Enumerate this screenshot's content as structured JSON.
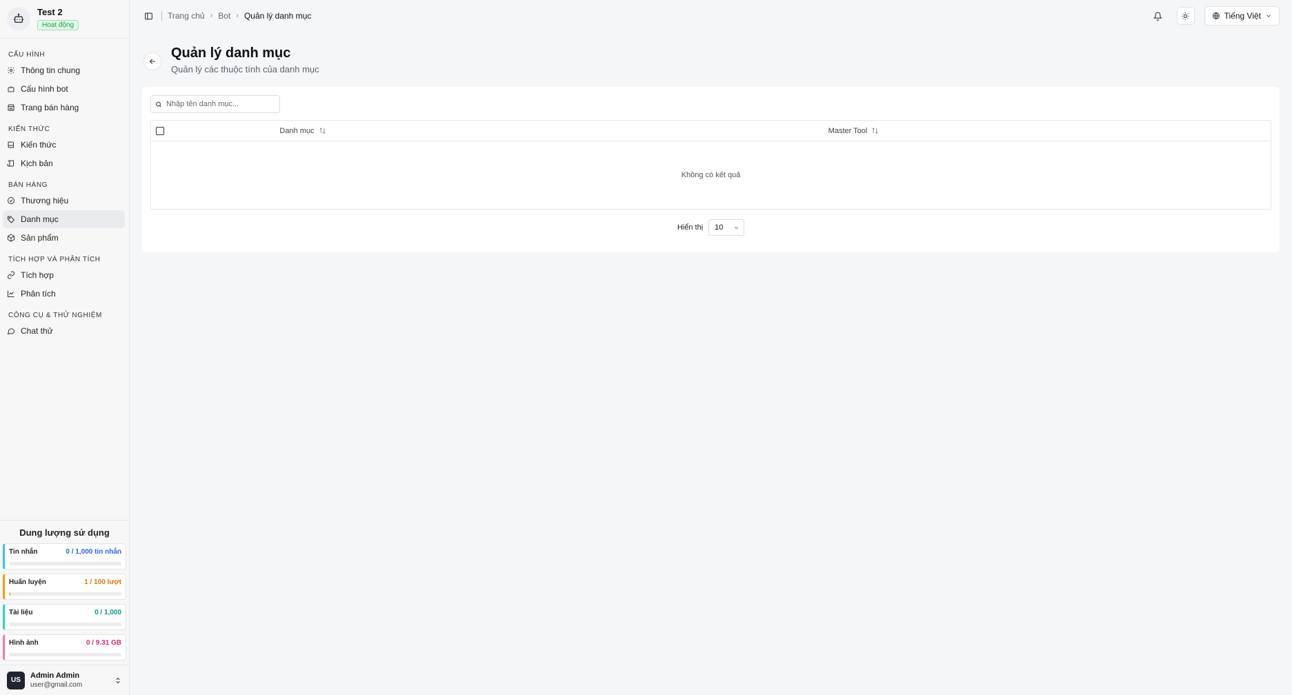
{
  "bot": {
    "name": "Test 2",
    "status": "Hoạt động"
  },
  "nav": {
    "sections": [
      {
        "title": "CẤU HÌNH",
        "items": [
          {
            "label": "Thông tin chung",
            "icon": "gear-icon"
          },
          {
            "label": "Cấu hình bot",
            "icon": "bot-config-icon"
          },
          {
            "label": "Trang bán hàng",
            "icon": "store-icon"
          }
        ]
      },
      {
        "title": "KIẾN THỨC",
        "items": [
          {
            "label": "Kiến thức",
            "icon": "book-icon"
          },
          {
            "label": "Kịch bản",
            "icon": "script-icon"
          }
        ]
      },
      {
        "title": "BÁN HÀNG",
        "items": [
          {
            "label": "Thương hiệu",
            "icon": "brand-icon"
          },
          {
            "label": "Danh mục",
            "icon": "tag-icon",
            "active": true
          },
          {
            "label": "Sản phẩm",
            "icon": "package-icon"
          }
        ]
      },
      {
        "title": "TÍCH HỢP VÀ PHÂN TÍCH",
        "items": [
          {
            "label": "Tích hợp",
            "icon": "link-icon"
          },
          {
            "label": "Phân tích",
            "icon": "chart-icon"
          }
        ]
      },
      {
        "title": "CÔNG CỤ & THỬ NGHIỆM",
        "items": [
          {
            "label": "Chat thử",
            "icon": "chat-icon"
          }
        ]
      }
    ]
  },
  "usage": {
    "title": "Dung lượng sử dụng",
    "items": [
      {
        "label": "Tin nhắn",
        "value": "0 / 1,000 tin nhắn",
        "color": "#2563eb",
        "border": "#38bdf8",
        "fraction": 0
      },
      {
        "label": "Huấn luyện",
        "value": "1 / 100 lượt",
        "color": "#d97706",
        "border": "#f59e0b",
        "fraction": 0.01
      },
      {
        "label": "Tài liệu",
        "value": "0 / 1,000",
        "color": "#0d9488",
        "border": "#2dd4bf",
        "fraction": 0
      },
      {
        "label": "Hình ảnh",
        "value": "0 / 9.31 GB",
        "color": "#db2777",
        "border": "#f472b6",
        "fraction": 0
      }
    ]
  },
  "user": {
    "initials": "US",
    "name": "Admin Admin",
    "email": "user@gmail.com"
  },
  "breadcrumb": {
    "home": "Trang chủ",
    "bot": "Bot",
    "current": "Quản lý danh mục"
  },
  "language": "Tiếng Việt",
  "page": {
    "title": "Quản lý danh mục",
    "subtitle": "Quản lý các thuộc tính của danh mục"
  },
  "search": {
    "placeholder": "Nhập tên danh mục...",
    "value": ""
  },
  "table": {
    "columns": [
      "Danh mục",
      "Master Tool"
    ],
    "empty_text": "Không có kết quả"
  },
  "pagination": {
    "label": "Hiển thị",
    "page_size": "10"
  }
}
